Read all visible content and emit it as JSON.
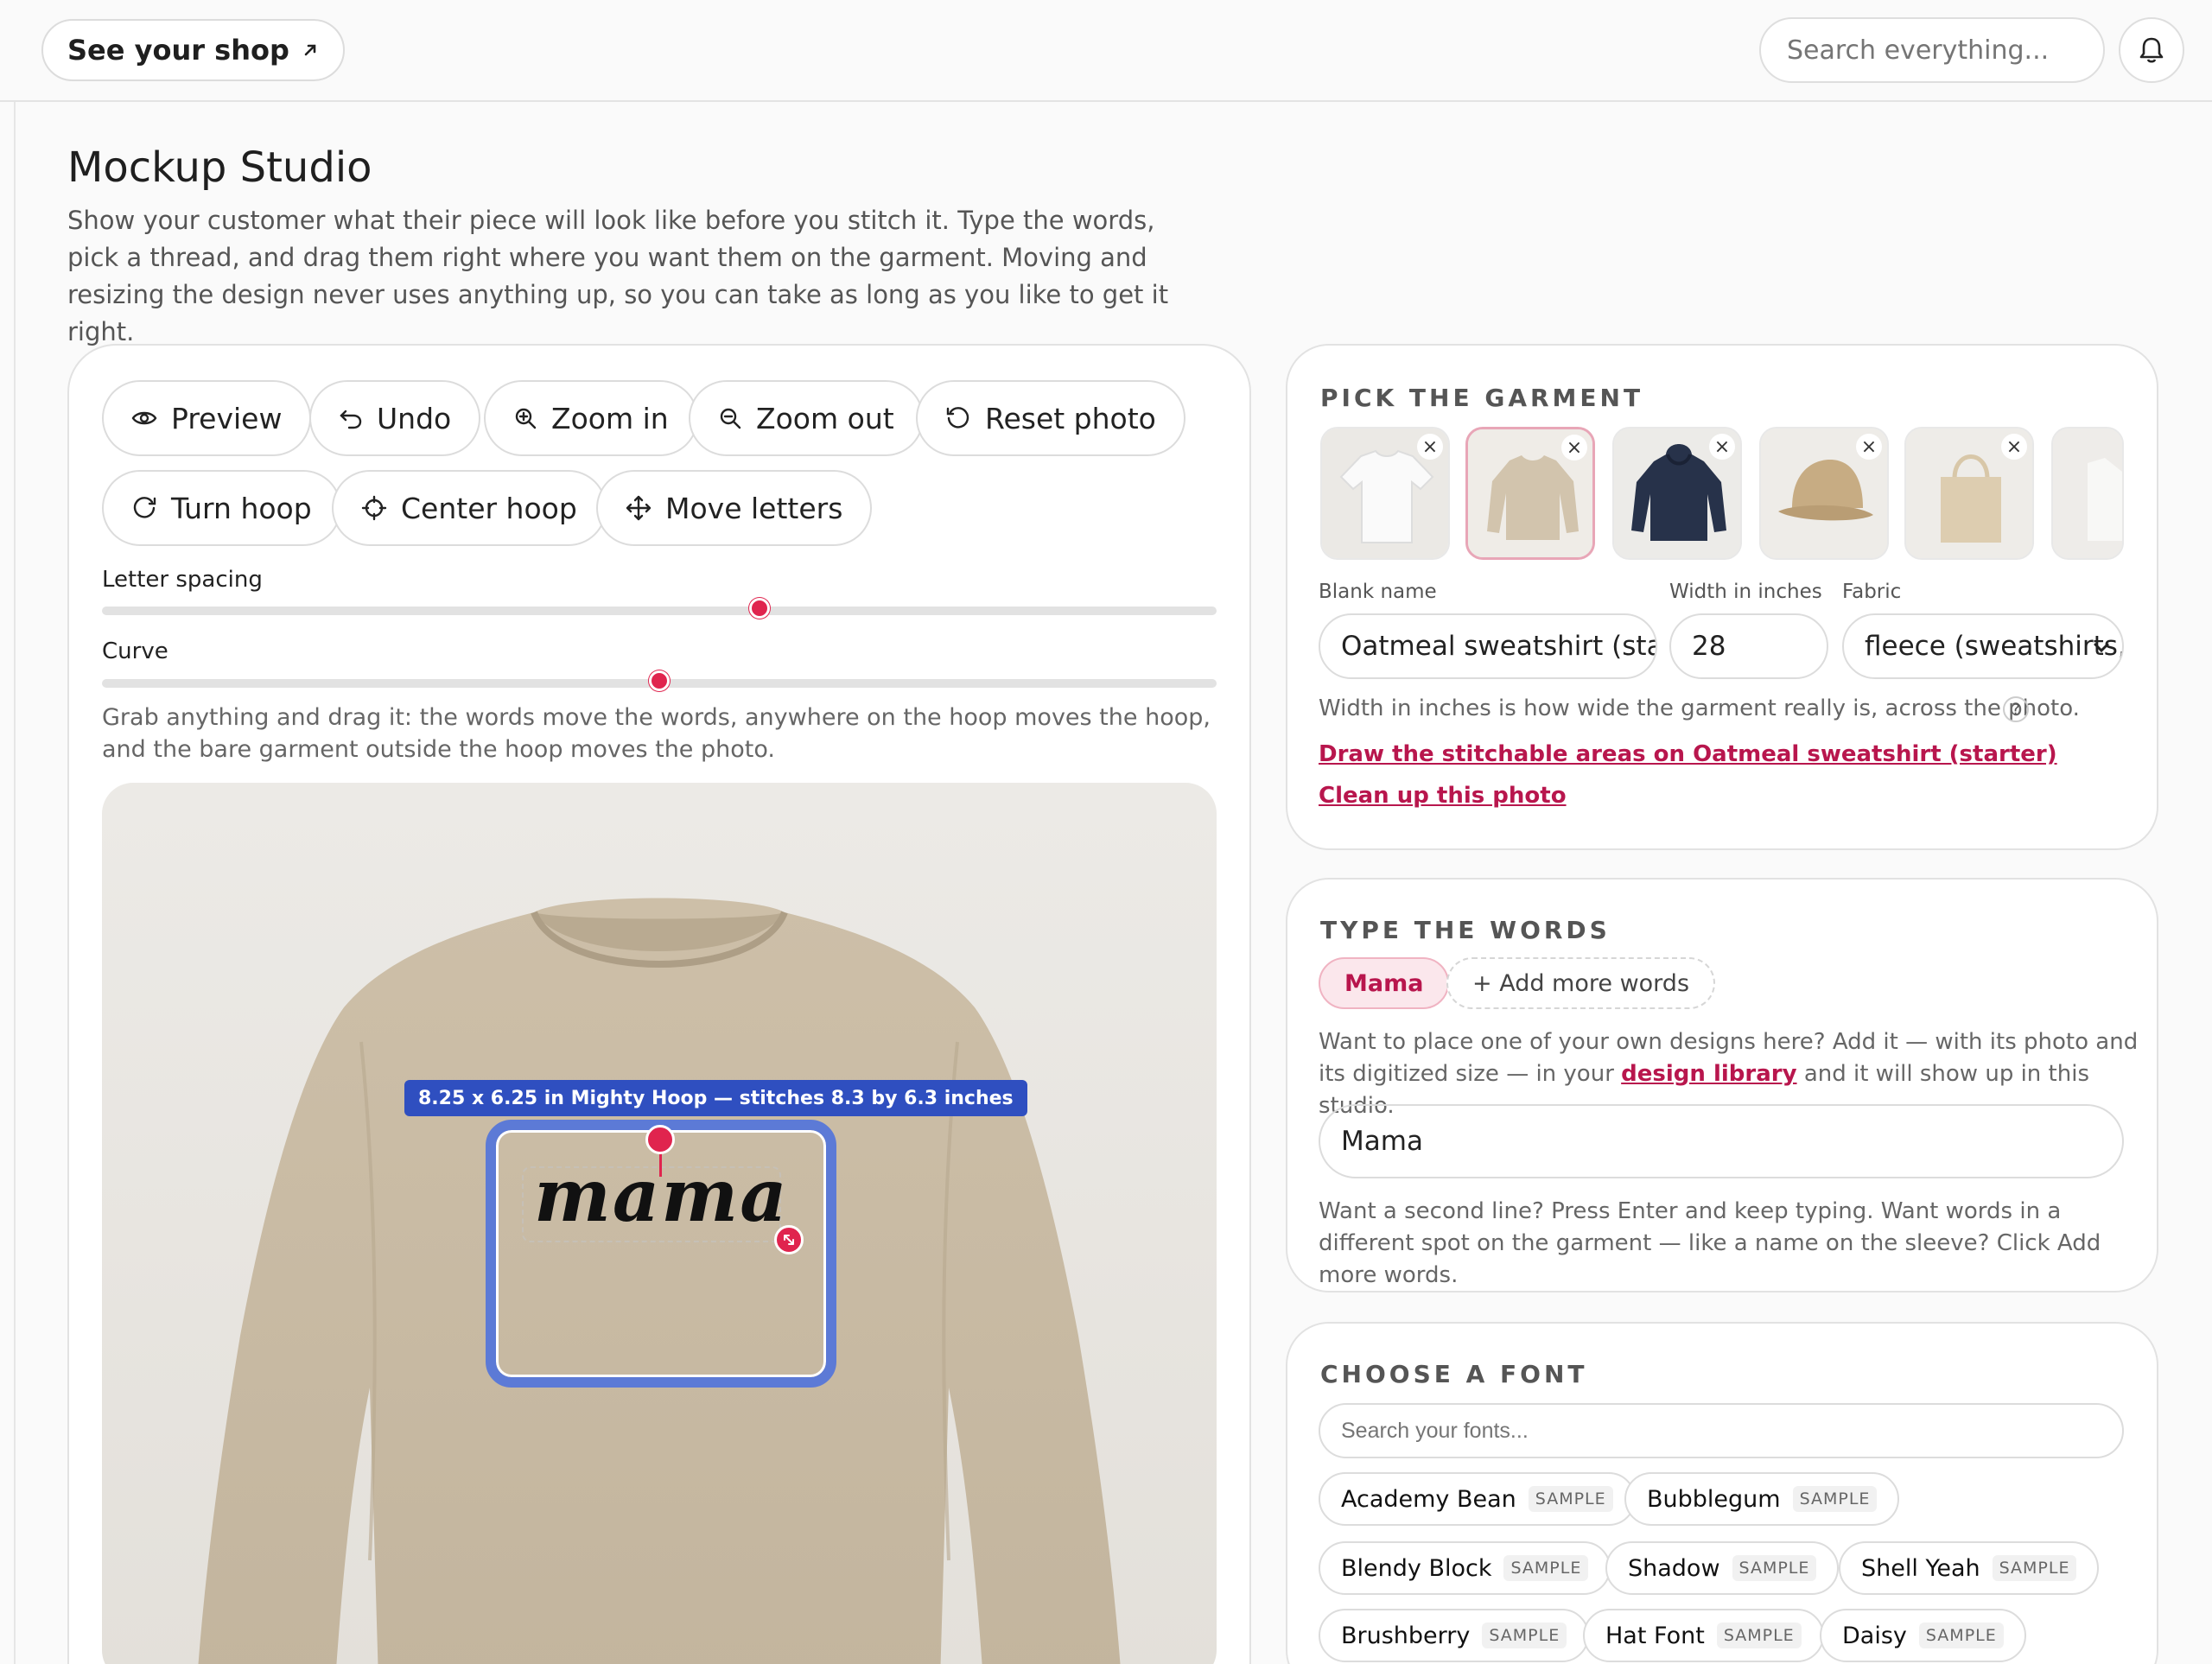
{
  "topbar": {
    "shop_label": "See your shop",
    "shop_icon": "external-arrow-icon",
    "search_placeholder": "Search everything...",
    "bell_icon": "bell-icon"
  },
  "page": {
    "title": "Mockup Studio",
    "subtitle": "Show your customer what their piece will look like before you stitch it. Type the words, pick a thread, and drag them right where you want them on the garment. Moving and resizing the design never uses anything up, so you can take as long as you like to get it right."
  },
  "toolbar": {
    "preview": "Preview",
    "undo": "Undo",
    "zoom_in": "Zoom in",
    "zoom_out": "Zoom out",
    "reset_photo": "Reset photo",
    "turn_hoop": "Turn hoop",
    "center_hoop": "Center hoop",
    "move_letters": "Move letters"
  },
  "sliders": {
    "letter_spacing_label": "Letter spacing",
    "letter_spacing_value": 0.59,
    "curve_label": "Curve",
    "curve_value": 0.5
  },
  "canvas": {
    "hint": "Grab anything and drag it: the words move the words, anywhere on the hoop moves the hoop, and the bare garment outside the hoop moves the photo.",
    "hoop_label": "8.25 x 6.25 in Mighty Hoop — stitches 8.3 by 6.3 inches",
    "design_text": "mama"
  },
  "garment_card": {
    "title": "PICK THE GARMENT",
    "garments": [
      "t-shirt",
      "sweatshirt",
      "hoodie",
      "cap",
      "tote",
      "onesie"
    ],
    "selected_index": 1,
    "blank_name_label": "Blank name",
    "blank_name_value": "Oatmeal sweatshirt (starter)",
    "width_label": "Width in inches",
    "width_value": "28",
    "fabric_label": "Fabric",
    "fabric_value": "fleece (sweatshirts, hoodies)",
    "width_note": "Width in inches is how wide the garment really is, across the photo.",
    "help": "?",
    "draw_link": "Draw the stitchable areas on Oatmeal sweatshirt (starter)",
    "cleanup_link": "Clean up this photo"
  },
  "words_card": {
    "title": "TYPE THE WORDS",
    "active_chip": "Mama",
    "add_chip": "+ Add more words",
    "note_part1": "Want to place one of your own designs here? Add it — with its photo and its digitized size — in your",
    "note_link": "design library",
    "note_part2": "and it will show up in this studio.",
    "input_value": "Mama",
    "note2": "Want a second line? Press Enter and keep typing. Want words in a different spot on the garment — like a name on the sleeve? Click Add more words."
  },
  "font_card": {
    "title": "CHOOSE A FONT",
    "search_placeholder": "Search your fonts...",
    "sample_tag": "SAMPLE",
    "fonts": [
      "Academy Bean",
      "Bubblegum",
      "Blendy Block",
      "Shadow",
      "Shell Yeah",
      "Brushberry",
      "Hat Font",
      "Daisy"
    ]
  },
  "colors": {
    "accent": "#e0244e",
    "link": "#b8164d",
    "hoop": "#5c7ad6",
    "hoop_label_bg": "#2f4fc0"
  }
}
